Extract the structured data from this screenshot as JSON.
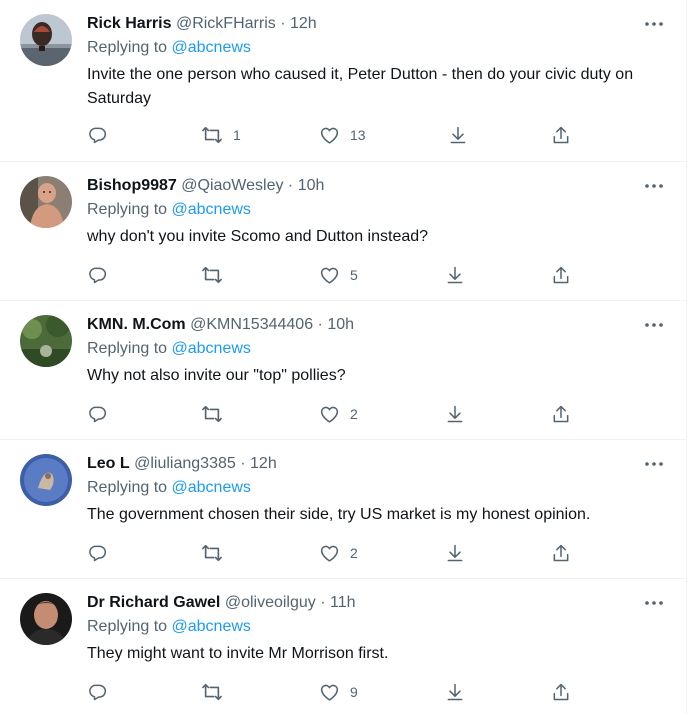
{
  "tweets": [
    {
      "name": "Rick Harris",
      "handle": "@RickFHarris",
      "dot": "·",
      "time": "12h",
      "replying_label": "Replying to",
      "replying_to": "@abcnews",
      "text": "Invite the one person who caused it, Peter Dutton - then do your civic duty on Saturday",
      "replies": "",
      "retweets": "1",
      "likes": "13",
      "avatar": "hot-air-balloon"
    },
    {
      "name": "Bishop9987",
      "handle": "@QiaoWesley",
      "dot": "·",
      "time": "10h",
      "replying_label": "Replying to",
      "replying_to": "@abcnews",
      "text": "why don't you invite Scomo and Dutton instead?",
      "replies": "",
      "retweets": "",
      "likes": "5",
      "avatar": "person-shirtless"
    },
    {
      "name": "KMN. M.Com",
      "handle": "@KMN15344406",
      "dot": "·",
      "time": "10h",
      "replying_label": "Replying to",
      "replying_to": "@abcnews",
      "text": "Why not also invite our \"top\" pollies?",
      "replies": "",
      "retweets": "",
      "likes": "2",
      "avatar": "garden"
    },
    {
      "name": "Leo L",
      "handle": "@liuliang3385",
      "dot": "·",
      "time": "12h",
      "replying_label": "Replying to",
      "replying_to": "@abcnews",
      "text": "The government chosen their side, try US market is my honest opinion.",
      "replies": "",
      "retweets": "",
      "likes": "2",
      "avatar": "blue-art"
    },
    {
      "name": "Dr Richard Gawel",
      "handle": "@oliveoilguy",
      "dot": "·",
      "time": "11h",
      "replying_label": "Replying to",
      "replying_to": "@abcnews",
      "text": "They might want to invite Mr Morrison first.",
      "replies": "",
      "retweets": "",
      "likes": "9",
      "avatar": "person-portrait"
    }
  ],
  "colors": {
    "text": "#0f1419",
    "secondary": "#536471",
    "link": "#1d9bf0",
    "divider": "#eff3f4"
  },
  "icons": [
    "more-icon",
    "reply-icon",
    "retweet-icon",
    "like-icon",
    "download-icon",
    "share-icon"
  ]
}
